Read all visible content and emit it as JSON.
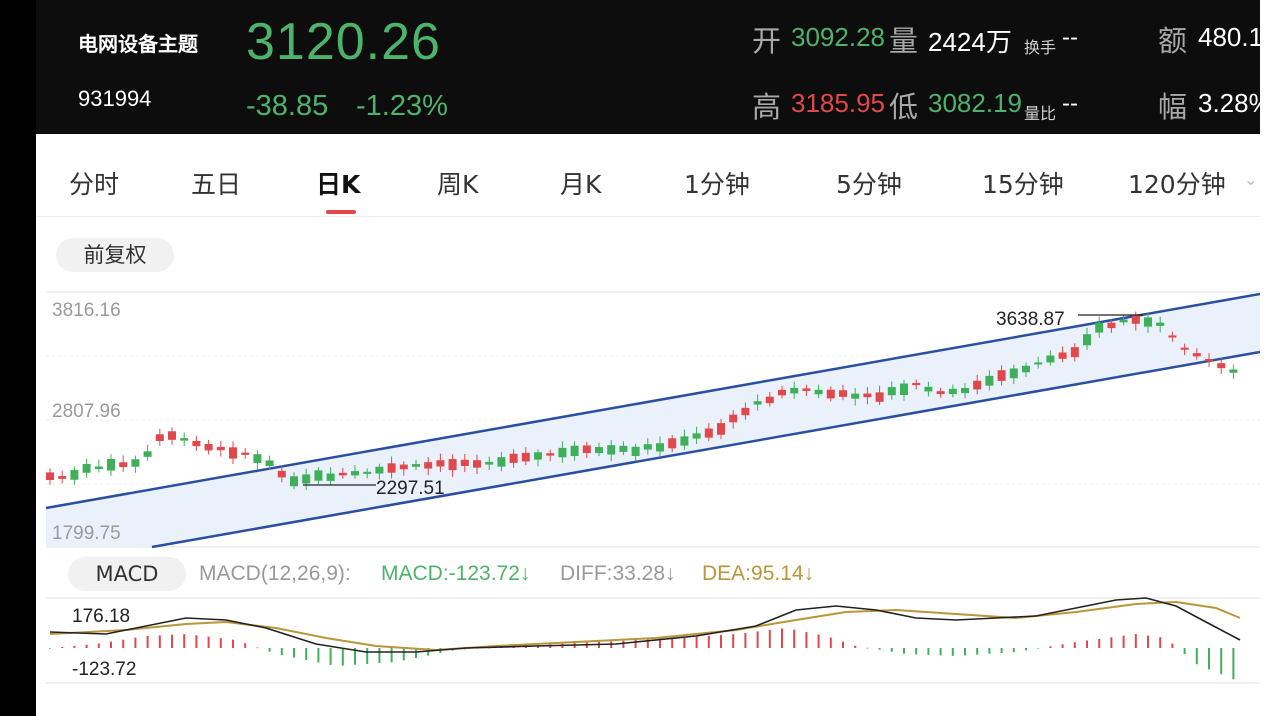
{
  "header": {
    "name": "电网设备主题",
    "code": "931994",
    "price": "3120.26",
    "change": "-38.85",
    "change_pct": "-1.23%",
    "stats": {
      "open_label": "开",
      "open": "3092.28",
      "volume_label": "量",
      "volume": "2424万",
      "turnover_label": "换手",
      "turnover": "--",
      "amount_label": "额",
      "amount": "480.1",
      "high_label": "高",
      "high": "3185.95",
      "low_label": "低",
      "low": "3082.19",
      "vol_ratio_label": "量比",
      "vol_ratio": "--",
      "amplitude_label": "幅",
      "amplitude": "3.28%"
    }
  },
  "tabs": [
    {
      "label": "分时"
    },
    {
      "label": "五日"
    },
    {
      "label": "日K",
      "active": true
    },
    {
      "label": "周K"
    },
    {
      "label": "月K"
    },
    {
      "label": "1分钟"
    },
    {
      "label": "5分钟"
    },
    {
      "label": "15分钟"
    },
    {
      "label": "120分钟"
    }
  ],
  "adjust_button": "前复权",
  "chart": {
    "y_ticks": [
      "3816.16",
      "2807.96",
      "1799.75"
    ],
    "high_marker": "3638.87",
    "low_marker": "2297.51",
    "colors": {
      "up": "#e0484b",
      "down": "#3fb05a",
      "channel": "#2a4fa0",
      "channel_fill": "#eaf1fb"
    }
  },
  "macd": {
    "button": "MACD",
    "name": "MACD(12,26,9):",
    "macd_value": "MACD:-123.72↓",
    "diff_value": "DIFF:33.28↓",
    "dea_value": "DEA:95.14↓",
    "y_top": "176.18",
    "y_bottom": "-123.72"
  }
}
